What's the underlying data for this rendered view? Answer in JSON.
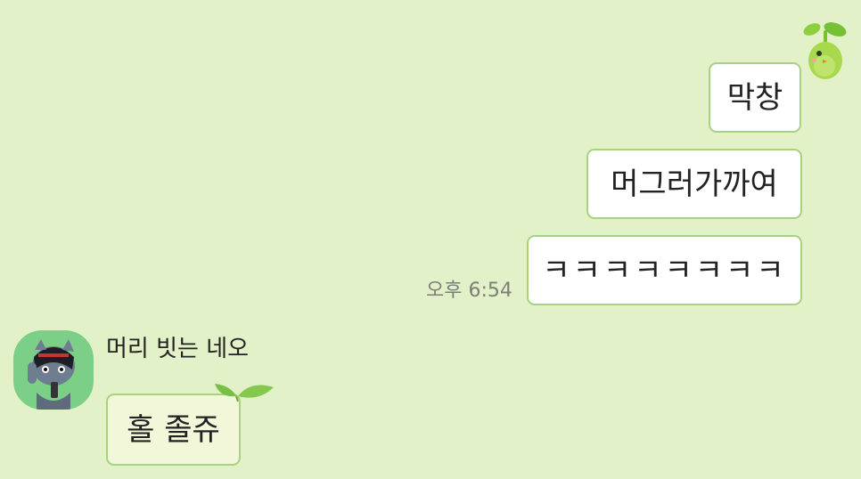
{
  "chat": {
    "my_messages": [
      {
        "text": "막창"
      },
      {
        "text": "머그러가까여"
      },
      {
        "text": "ㅋㅋㅋㅋㅋㅋㅋㅋ"
      }
    ],
    "my_timestamp": "오후 6:54",
    "other": {
      "sender_name": "머리 빗는 네오",
      "avatar_icon": "cat-character-avatar-icon",
      "messages": [
        {
          "text": "홀 졸쥬"
        }
      ]
    },
    "decorations": {
      "sprout_sticker_icon": "sprout-character-icon",
      "bubble_leaf_icon": "leaf-sprout-icon"
    }
  },
  "theme": {
    "background": "#e3f1c8",
    "bubble_border": "#a7d27f",
    "my_bubble_fill": "#ffffff",
    "other_bubble_fill": "#f1f7d8",
    "avatar_background": "#7ccf86"
  }
}
